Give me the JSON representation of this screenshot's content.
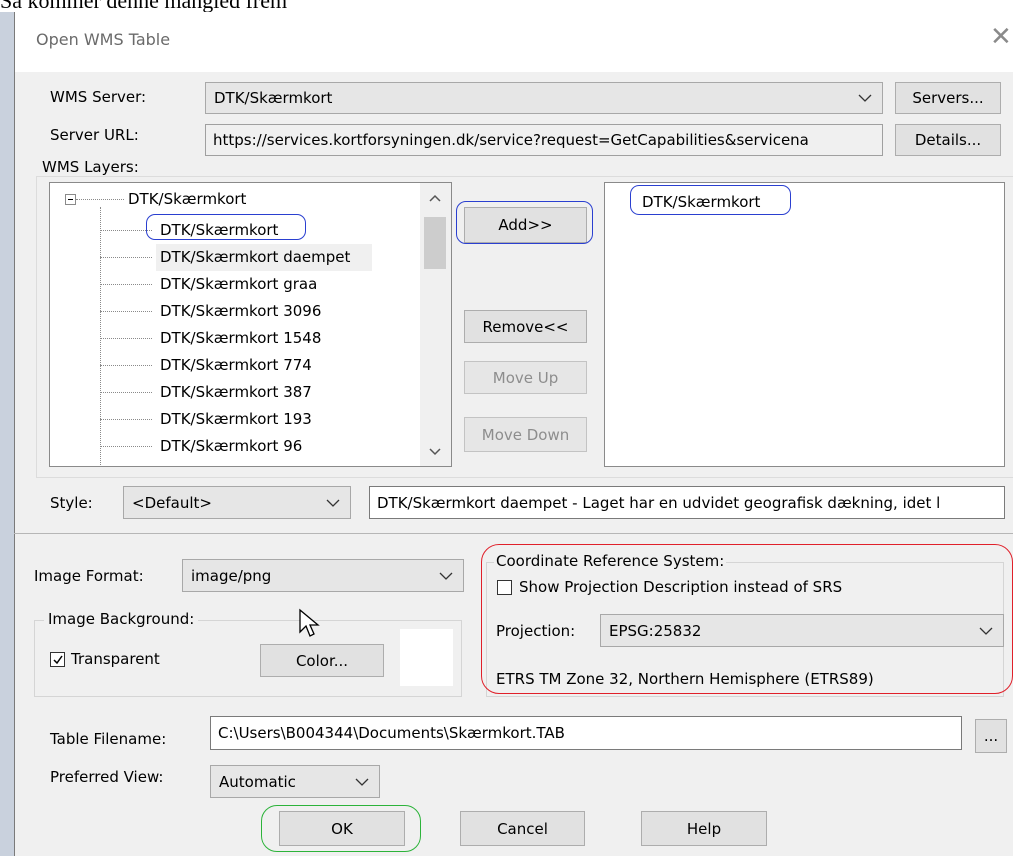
{
  "top_caption": "Så kommer denne mangled frem",
  "window": {
    "title": "Open WMS Table"
  },
  "server": {
    "label": "WMS Server:",
    "value": "DTK/Skærmkort",
    "servers_button": "Servers...",
    "url_label": "Server URL:",
    "url_value": "https://services.kortforsyningen.dk/service?request=GetCapabilities&servicena",
    "details_button": "Details..."
  },
  "layers": {
    "label": "WMS Layers:",
    "root": "DTK/Skærmkort",
    "items": [
      "DTK/Skærmkort",
      "DTK/Skærmkort daempet",
      "DTK/Skærmkort graa",
      "DTK/Skærmkort 3096",
      "DTK/Skærmkort 1548",
      "DTK/Skærmkort 774",
      "DTK/Skærmkort 387",
      "DTK/Skærmkort 193",
      "DTK/Skærmkort 96"
    ],
    "selected": [
      "DTK/Skærmkort"
    ]
  },
  "buttons": {
    "add": "Add>>",
    "remove": "Remove<<",
    "move_up": "Move Up",
    "move_down": "Move Down"
  },
  "style": {
    "label": "Style:",
    "value": "<Default>",
    "description": "DTK/Skærmkort daempet - Laget har en udvidet geografisk dækning, idet l"
  },
  "image": {
    "format_label": "Image Format:",
    "format_value": "image/png",
    "background_label": "Image Background:",
    "transparent_label": "Transparent",
    "transparent_checked": true,
    "color_button": "Color..."
  },
  "crs": {
    "group_label": "Coordinate Reference System:",
    "show_desc_label": "Show Projection Description instead of SRS",
    "show_desc_checked": false,
    "projection_label": "Projection:",
    "projection_value": "EPSG:25832",
    "description": "ETRS TM Zone 32, Northern Hemisphere (ETRS89)"
  },
  "table": {
    "filename_label": "Table Filename:",
    "filename_value": "C:\\Users\\B004344\\Documents\\Skærmkort.TAB",
    "browse_button": "...",
    "preferred_view_label": "Preferred View:",
    "preferred_view_value": "Automatic"
  },
  "footer": {
    "ok": "OK",
    "cancel": "Cancel",
    "help": "Help"
  }
}
